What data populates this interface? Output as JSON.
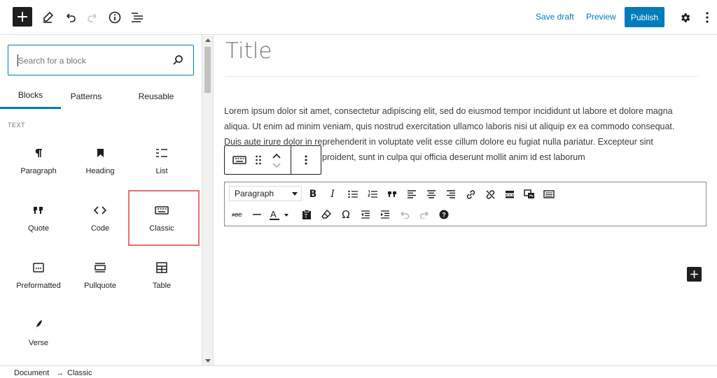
{
  "header": {
    "save_draft_label": "Save draft",
    "preview_label": "Preview",
    "publish_label": "Publish"
  },
  "inserter": {
    "search_placeholder": "Search for a block",
    "tabs": [
      "Blocks",
      "Patterns",
      "Reusable"
    ],
    "active_tab": "Blocks",
    "category": "TEXT",
    "blocks": [
      {
        "label": "Paragraph",
        "icon": "paragraph-icon"
      },
      {
        "label": "Heading",
        "icon": "heading-icon"
      },
      {
        "label": "List",
        "icon": "list-icon"
      },
      {
        "label": "Quote",
        "icon": "quote-icon"
      },
      {
        "label": "Code",
        "icon": "code-icon"
      },
      {
        "label": "Classic",
        "icon": "keyboard-icon"
      },
      {
        "label": "Preformatted",
        "icon": "preformatted-icon"
      },
      {
        "label": "Pullquote",
        "icon": "pullquote-icon"
      },
      {
        "label": "Table",
        "icon": "table-icon"
      },
      {
        "label": "Verse",
        "icon": "verse-icon"
      }
    ]
  },
  "editor": {
    "title_placeholder": "Title",
    "paragraph_line1": "Lorem ipsum dolor sit amet, consectetur adipiscing elit, sed do eiusmod tempor incididunt ut labore et dolore magna",
    "paragraph_line2": "aliqua. Ut enim ad minim veniam, quis nostrud exercitation ullamco laboris nisi ut aliquip ex ea commodo consequat.",
    "paragraph_line3": "Duis aute irure dolor in reprehenderit in voluptate velit esse cillum dolore eu fugiat nulla pariatur. Excepteur sint",
    "paragraph_line4": "proident, sunt in culpa qui officia deserunt mollit anim id est laborum",
    "classic_format_value": "Paragraph"
  },
  "footer": {
    "breadcrumb": [
      "Document",
      "Classic"
    ],
    "separator": "→"
  },
  "colors": {
    "accent": "#007cba",
    "highlight": "#e26f6f"
  }
}
